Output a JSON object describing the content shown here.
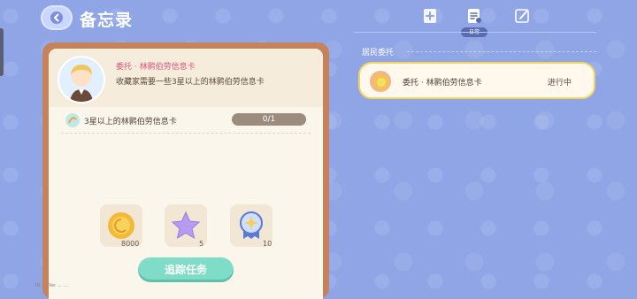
{
  "header": {
    "title": "备忘录"
  },
  "tabs": [
    {
      "icon": "add-note-icon"
    },
    {
      "icon": "daily-note-icon",
      "label": "日常",
      "active": true
    },
    {
      "icon": "edit-note-icon"
    }
  ],
  "sidebar": {
    "section_title": "居民委托",
    "items": [
      {
        "icon": "coin-medal-icon",
        "name": "委托 · 林鹮伯劳信息卡",
        "status": "进行中"
      }
    ]
  },
  "detail": {
    "requester_title": "委托 · 林鹮伯劳信息卡",
    "description": "收藏家需要一些3星以上的林鹮伯劳信息卡",
    "objective": "3星以上的林鹮伯劳信息卡",
    "progress": "0/1",
    "rewards": [
      {
        "icon": "gold-coin-icon",
        "count": "8000"
      },
      {
        "icon": "purple-star-icon",
        "count": "5"
      },
      {
        "icon": "blue-badge-icon",
        "count": "10"
      }
    ],
    "track_button": "追踪任务",
    "footer": "ID: ... Ver ... ...."
  },
  "colors": {
    "background": "#8fa5e6",
    "card_border": "#c5825b",
    "track_button": "#7fdcc6",
    "task_border": "#f4d35e",
    "accent_text": "#e0507a"
  }
}
